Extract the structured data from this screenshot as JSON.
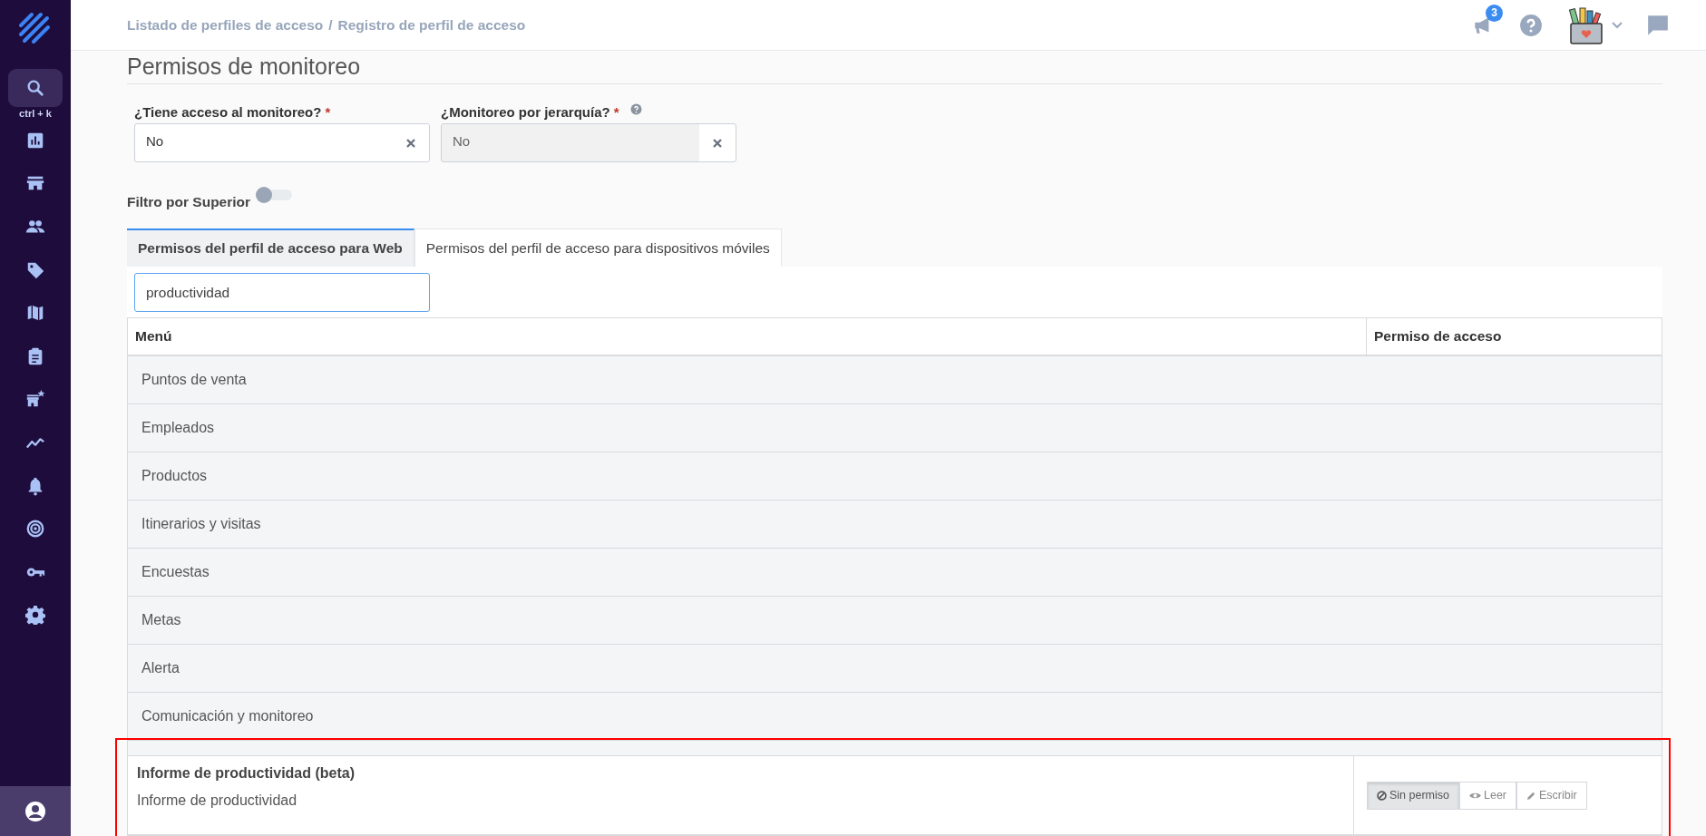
{
  "sidebar": {
    "search_hint": "ctrl + k"
  },
  "header": {
    "breadcrumb": [
      {
        "label": "Listado de perfiles de acceso"
      },
      {
        "label": "Registro de perfil de acceso"
      }
    ],
    "separator": "/",
    "notifications": "3"
  },
  "section": {
    "title": "Permisos de monitoreo"
  },
  "fields": [
    {
      "label": "¿Tiene acceso al monitoreo?",
      "required_mark": "*",
      "value": "No",
      "disabled": false
    },
    {
      "label": "¿Monitoreo por jerarquía?",
      "required_mark": "*",
      "help": true,
      "value": "No",
      "disabled": true
    }
  ],
  "toggle": {
    "label": "Filtro por Superior",
    "on": false
  },
  "tabs": [
    {
      "label": "Permisos del perfil de acceso para Web",
      "selected": true
    },
    {
      "label": "Permisos del perfil de acceso para dispositivos móviles",
      "selected": false
    }
  ],
  "filter": {
    "value": "productividad"
  },
  "table": {
    "columns": [
      "Menú",
      "Permiso de acceso"
    ],
    "rows": [
      {
        "kind": "group",
        "label": "Puntos de venta"
      },
      {
        "kind": "group",
        "label": "Empleados"
      },
      {
        "kind": "group",
        "label": "Productos"
      },
      {
        "kind": "group",
        "label": "Itinerarios y visitas"
      },
      {
        "kind": "group",
        "label": "Encuestas"
      },
      {
        "kind": "group",
        "label": "Metas"
      },
      {
        "kind": "group",
        "label": "Alerta"
      },
      {
        "kind": "group",
        "label": "Comunicación y monitoreo"
      },
      {
        "kind": "item",
        "title": "Informe de productividad (beta)",
        "label": "Informe de productividad",
        "highlight": true,
        "options": [
          {
            "kind": "none",
            "label": "Sin permiso",
            "selected": true
          },
          {
            "kind": "read",
            "label": "Leer",
            "selected": false
          },
          {
            "kind": "write",
            "label": "Escribir",
            "selected": false
          }
        ]
      }
    ]
  }
}
